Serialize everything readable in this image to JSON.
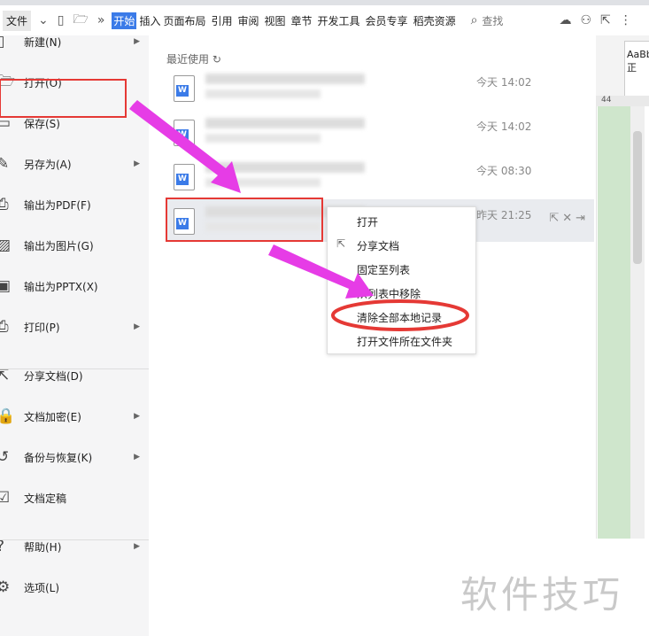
{
  "toolbar": {
    "file": "文件",
    "tabs": [
      "开始",
      "插入",
      "页面布局",
      "引用",
      "审阅",
      "视图",
      "章节",
      "开发工具",
      "会员专享",
      "稻壳资源"
    ],
    "search": "查找"
  },
  "menu": [
    {
      "label": "新建(N)",
      "icon": "new-file-icon",
      "arrow": true
    },
    {
      "label": "打开(O)",
      "icon": "folder-open-icon",
      "arrow": false
    },
    {
      "label": "保存(S)",
      "icon": "save-icon",
      "arrow": false
    },
    {
      "label": "另存为(A)",
      "icon": "save-as-icon",
      "arrow": true
    },
    {
      "label": "输出为PDF(F)",
      "icon": "pdf-icon",
      "arrow": false
    },
    {
      "label": "输出为图片(G)",
      "icon": "image-icon",
      "arrow": false
    },
    {
      "label": "输出为PPTX(X)",
      "icon": "pptx-icon",
      "arrow": false
    },
    {
      "label": "打印(P)",
      "icon": "print-icon",
      "arrow": true
    },
    {
      "label": "分享文档(D)",
      "icon": "share-icon",
      "arrow": false
    },
    {
      "label": "文档加密(E)",
      "icon": "lock-icon",
      "arrow": true
    },
    {
      "label": "备份与恢复(K)",
      "icon": "backup-icon",
      "arrow": true
    },
    {
      "label": "文档定稿",
      "icon": "finalize-icon",
      "arrow": false
    },
    {
      "label": "帮助(H)",
      "icon": "help-icon",
      "arrow": true
    },
    {
      "label": "选项(L)",
      "icon": "gear-icon",
      "arrow": false
    }
  ],
  "recent": {
    "title": "最近使用",
    "files": [
      {
        "time": "今天 14:02"
      },
      {
        "time": "今天 14:02"
      },
      {
        "time": "今天 08:30"
      },
      {
        "time": "昨天 21:25"
      }
    ]
  },
  "context_menu": [
    "打开",
    "分享文档",
    "固定至列表",
    "从列表中移除",
    "清除全部本地记录",
    "打开文件所在文件夹"
  ],
  "ribbon": {
    "style": "AaBb",
    "style2": "正",
    "ruler": "44"
  },
  "watermark": "软件技巧",
  "colors": {
    "accent": "#3b7be8",
    "annotation": "#e53935",
    "arrow": "#e63ce6"
  }
}
